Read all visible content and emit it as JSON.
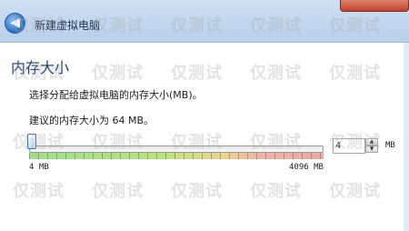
{
  "header": {
    "back_icon_glyph": "◀",
    "title": "新建虚拟电脑"
  },
  "page": {
    "heading": "内存大小",
    "instruction": "选择分配给虚拟电脑的内存大小(MB)。",
    "recommendation": "建议的内存大小为 64 MB。"
  },
  "memory": {
    "value": "4",
    "unit": "MB",
    "min_label": "4 MB",
    "max_label": "4096 MB",
    "slider_fraction": 0
  },
  "spinner": {
    "up_glyph": "▲",
    "down_glyph": "▼"
  },
  "watermark": {
    "text": "仅测试"
  },
  "colors": {
    "titlebar": "#c2d7ee",
    "heading": "#193d78",
    "slider_low": "#9de08a",
    "slider_high": "#eeaaa0"
  }
}
